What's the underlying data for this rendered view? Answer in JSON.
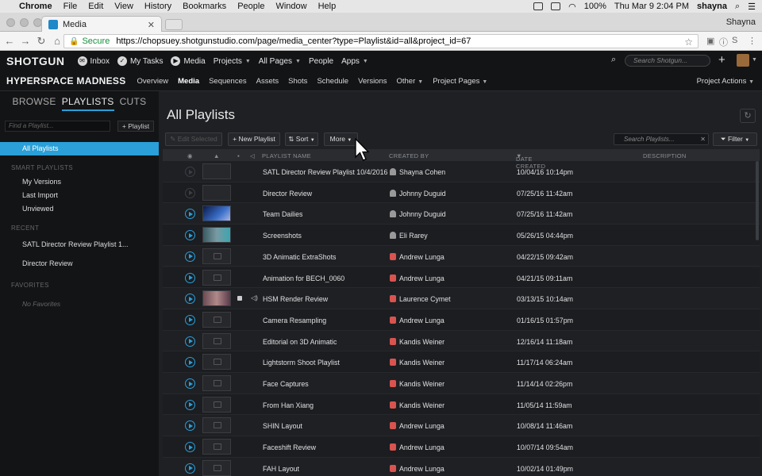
{
  "macmenu": {
    "app": "Chrome",
    "items": [
      "File",
      "Edit",
      "View",
      "History",
      "Bookmarks",
      "People",
      "Window",
      "Help"
    ],
    "clock": "Thu Mar 9  2:04 PM",
    "battery": "100%",
    "user": "shayna"
  },
  "browser": {
    "tab_title": "Media",
    "profile": "Shayna",
    "secure_label": "Secure",
    "url": "https://chopsuey.shotgunstudio.com/page/media_center?type=Playlist&id=all&project_id=67"
  },
  "topnav": {
    "logo": "SHOTGUN",
    "items": [
      {
        "label": "Inbox"
      },
      {
        "label": "My Tasks"
      },
      {
        "label": "Media"
      },
      {
        "label": "Projects"
      },
      {
        "label": "All Pages"
      },
      {
        "label": "People"
      },
      {
        "label": "Apps"
      }
    ],
    "search_placeholder": "Search Shotgun..."
  },
  "project": {
    "name": "HYPERSPACE MADNESS",
    "nav": [
      "Overview",
      "Media",
      "Sequences",
      "Assets",
      "Shots",
      "Schedule",
      "Versions",
      "Other",
      "Project Pages"
    ],
    "active": "Media",
    "actions": "Project Actions"
  },
  "sidebar": {
    "tabs": [
      "BROWSE",
      "PLAYLISTS",
      "CUTS"
    ],
    "active_tab": "PLAYLISTS",
    "find_placeholder": "Find a Playlist...",
    "add_btn": "Playlist",
    "all_playlists": "All Playlists",
    "smart_title": "SMART PLAYLISTS",
    "smart": [
      "My Versions",
      "Last Import",
      "Unviewed"
    ],
    "recent_title": "RECENT",
    "recent": [
      "SATL Director Review Playlist 1...",
      "Director Review"
    ],
    "fav_title": "FAVORITES",
    "no_fav": "No Favorites"
  },
  "main": {
    "title": "All Playlists",
    "edit_selected": "Edit Selected",
    "new_playlist": "New Playlist",
    "sort": "Sort",
    "more": "More",
    "search_placeholder": "Search Playlists...",
    "filter": "Filter",
    "columns": {
      "name": "PLAYLIST NAME",
      "created_by": "CREATED BY",
      "date": "DATE CREATED",
      "desc": "DESCRIPTION"
    }
  },
  "rows": [
    {
      "name": "SATL Director Review Playlist 10/4/2016",
      "by": "Shayna Cohen",
      "date": "10/04/16 10:14pm",
      "thumb": "empty",
      "play": "dim",
      "uicon": "person"
    },
    {
      "name": "Director Review",
      "by": "Johnny Duguid",
      "date": "07/25/16 11:42am",
      "thumb": "empty",
      "play": "dim",
      "uicon": "person"
    },
    {
      "name": "Team Dailies",
      "by": "Johnny Duguid",
      "date": "07/25/16 11:42am",
      "thumb": "t-space",
      "play": "on",
      "uicon": "person"
    },
    {
      "name": "Screenshots",
      "by": "Eli Rarey",
      "date": "05/26/15 04:44pm",
      "thumb": "t-shot",
      "play": "on",
      "uicon": "person"
    },
    {
      "name": "3D Animatic ExtraShots",
      "by": "Andrew Lunga",
      "date": "04/22/15 09:42am",
      "thumb": "cam",
      "play": "on",
      "uicon": "red"
    },
    {
      "name": "Animation for BECH_0060",
      "by": "Andrew Lunga",
      "date": "04/21/15 09:11am",
      "thumb": "cam",
      "play": "on",
      "uicon": "red"
    },
    {
      "name": "HSM Render Review",
      "by": "Laurence Cymet",
      "date": "03/13/15 10:14am",
      "thumb": "t-hsm",
      "play": "on",
      "uicon": "red",
      "locked": true
    },
    {
      "name": "Camera Resampling",
      "by": "Andrew Lunga",
      "date": "01/16/15 01:57pm",
      "thumb": "cam",
      "play": "on",
      "uicon": "red"
    },
    {
      "name": "Editorial on 3D Animatic",
      "by": "Kandis Weiner",
      "date": "12/16/14 11:18am",
      "thumb": "cam",
      "play": "on",
      "uicon": "red"
    },
    {
      "name": "Lightstorm Shoot Playlist",
      "by": "Kandis Weiner",
      "date": "11/17/14 06:24am",
      "thumb": "cam",
      "play": "on",
      "uicon": "red"
    },
    {
      "name": "Face Captures",
      "by": "Kandis Weiner",
      "date": "11/14/14 02:26pm",
      "thumb": "cam",
      "play": "on",
      "uicon": "red"
    },
    {
      "name": "From Han Xiang",
      "by": "Kandis Weiner",
      "date": "11/05/14 11:59am",
      "thumb": "cam",
      "play": "on",
      "uicon": "red"
    },
    {
      "name": "SHIN Layout",
      "by": "Andrew Lunga",
      "date": "10/08/14 11:46am",
      "thumb": "cam",
      "play": "on",
      "uicon": "red"
    },
    {
      "name": "Faceshift Review",
      "by": "Andrew Lunga",
      "date": "10/07/14 09:54am",
      "thumb": "cam",
      "play": "on",
      "uicon": "red"
    },
    {
      "name": "FAH Layout",
      "by": "Andrew Lunga",
      "date": "10/02/14 01:49pm",
      "thumb": "cam",
      "play": "on",
      "uicon": "red"
    }
  ]
}
